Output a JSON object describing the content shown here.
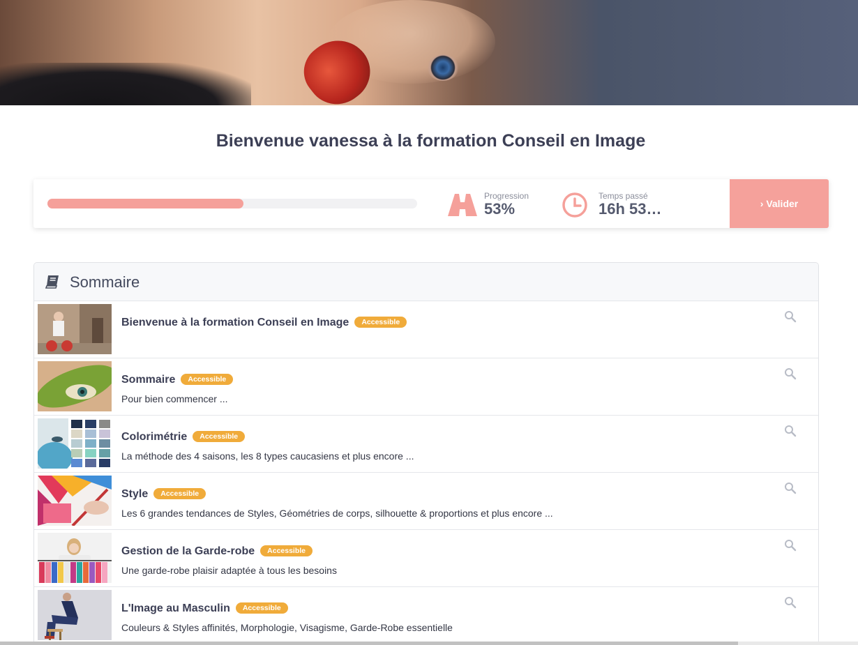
{
  "header": {
    "title": "Bienvenue vanessa à la formation Conseil en Image"
  },
  "progress": {
    "fraction": 0.53,
    "progression_label": "Progression",
    "progression_value": "53%",
    "time_label": "Temps passé",
    "time_value": "16h 53mi…",
    "validate_label": "› Valider",
    "accent_color": "#f5a19b"
  },
  "summary": {
    "title": "Sommaire",
    "badge_color": "#f0ab3a",
    "items": [
      {
        "title": "Bienvenue à la formation Conseil en Image",
        "badge": "Accessible",
        "description": ""
      },
      {
        "title": "Sommaire",
        "badge": "Accessible",
        "description": "Pour bien commencer ..."
      },
      {
        "title": "Colorimétrie",
        "badge": "Accessible",
        "description": "La méthode des 4 saisons, les 8 types caucasiens et plus encore ..."
      },
      {
        "title": "Style",
        "badge": "Accessible",
        "description": "Les 6 grandes tendances de Styles, Géométries de corps, silhouette & proportions et plus encore ..."
      },
      {
        "title": "Gestion de la Garde-robe",
        "badge": "Accessible",
        "description": "Une garde-robe plaisir adaptée à tous les besoins"
      },
      {
        "title": "L'Image au Masculin",
        "badge": "Accessible",
        "description": "Couleurs & Styles affinités, Morphologie, Visagisme, Garde-Robe essentielle"
      }
    ]
  }
}
